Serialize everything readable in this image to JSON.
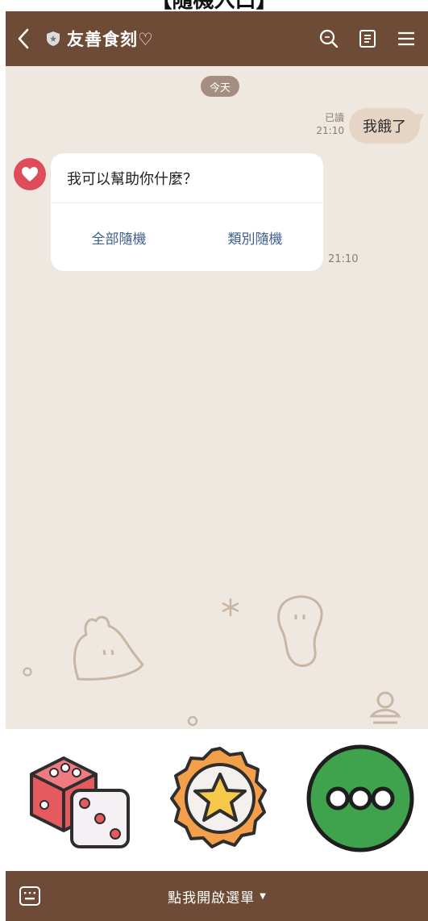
{
  "caption": "【隨機入口】",
  "header": {
    "title": "友善食刻♡",
    "back_icon": "chevron-left-icon",
    "search_icon": "search-icon",
    "notes_icon": "notes-icon",
    "menu_icon": "hamburger-icon",
    "bg_color": "#6e4b36"
  },
  "chat": {
    "date_label": "今天",
    "user_message": {
      "text": "我餓了",
      "read_label": "已讀",
      "time": "21:10"
    },
    "bot_message": {
      "question": "我可以幫助你什麼？",
      "actions": [
        "全部隨機",
        "類別隨機"
      ],
      "time": "21:10"
    },
    "bg_color": "#efe8e1"
  },
  "rich_menu": {
    "items": [
      {
        "icon": "dice-icon"
      },
      {
        "icon": "star-badge-icon"
      },
      {
        "icon": "more-icon"
      }
    ]
  },
  "footer": {
    "label": "點我開啟選單",
    "keyboard_icon": "keyboard-icon"
  }
}
